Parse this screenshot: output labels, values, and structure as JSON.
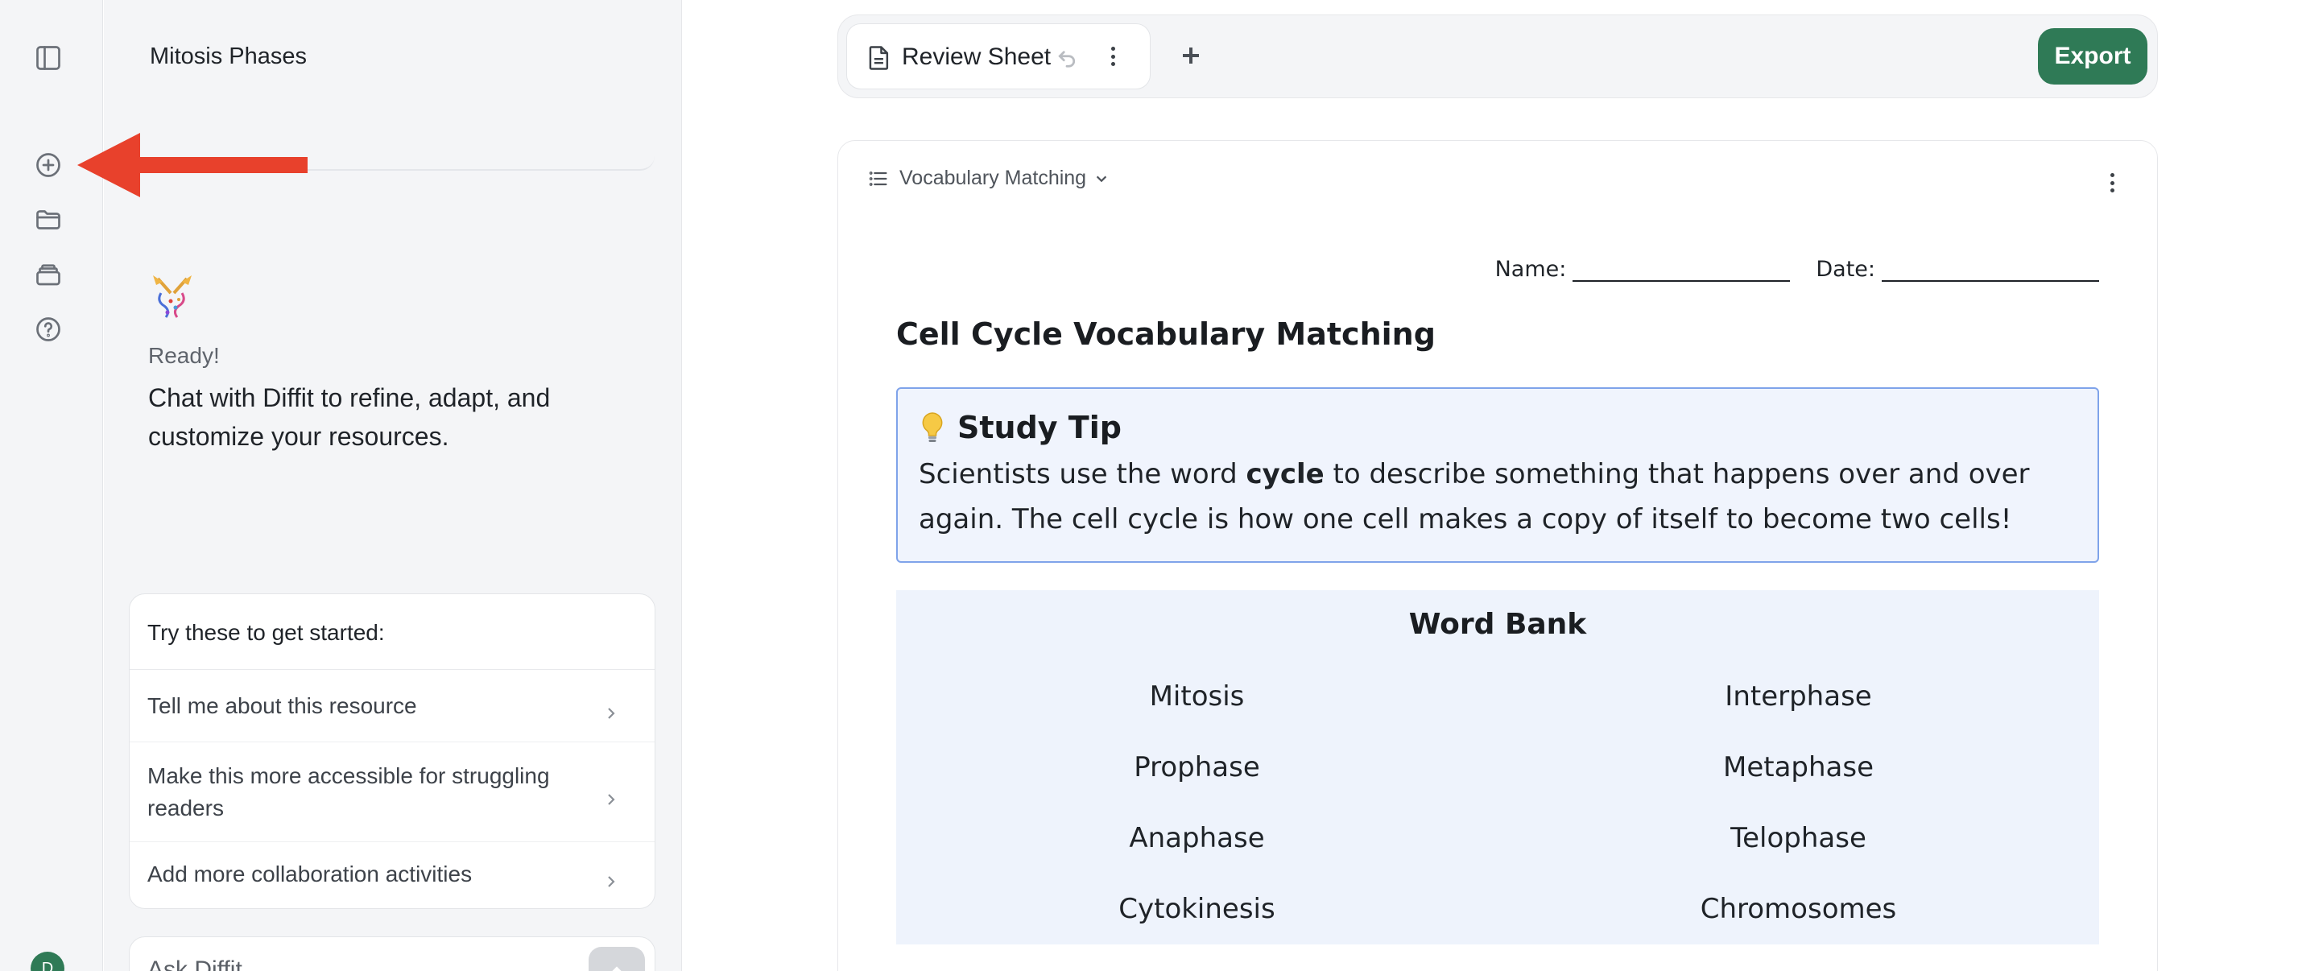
{
  "rail": {
    "icons": [
      "sidebar-toggle-icon",
      "new-chat-icon",
      "folder-icon",
      "library-icon",
      "help-icon"
    ],
    "avatar_initial": "D",
    "accent": "#2f7a56"
  },
  "chat": {
    "title": "Mitosis Phases",
    "ready_label": "Ready!",
    "intro": "Chat with Diffit to refine, adapt, and customize your resources.",
    "suggestions_heading": "Try these to get started:",
    "suggestions": [
      {
        "label": "Tell me about this resource"
      },
      {
        "label": "Make this more accessible for struggling readers"
      },
      {
        "label": "Add more collaboration activities"
      }
    ],
    "input_placeholder": "Ask Diffit"
  },
  "annotation": {
    "type": "red-arrow",
    "color": "#e8412c",
    "points_to": "new-chat-icon"
  },
  "tabs": {
    "items": [
      {
        "label": "Review Sheet",
        "icon": "document-icon"
      }
    ],
    "export_label": "Export"
  },
  "document": {
    "section_label": "Vocabulary Matching",
    "name_label": "Name:",
    "date_label": "Date:",
    "title": "Cell Cycle Vocabulary Matching",
    "tip": {
      "heading": "Study Tip",
      "body_before": "Scientists use the word ",
      "body_bold": "cycle",
      "body_after": " to describe something that happens over and over again. The cell cycle is how one cell makes a copy of itself to become two cells!",
      "border_color": "#7fa3ea"
    },
    "word_bank": {
      "heading": "Word Bank",
      "words": [
        "Mitosis",
        "Interphase",
        "Prophase",
        "Metaphase",
        "Anaphase",
        "Telophase",
        "Cytokinesis",
        "Chromosomes"
      ]
    }
  }
}
